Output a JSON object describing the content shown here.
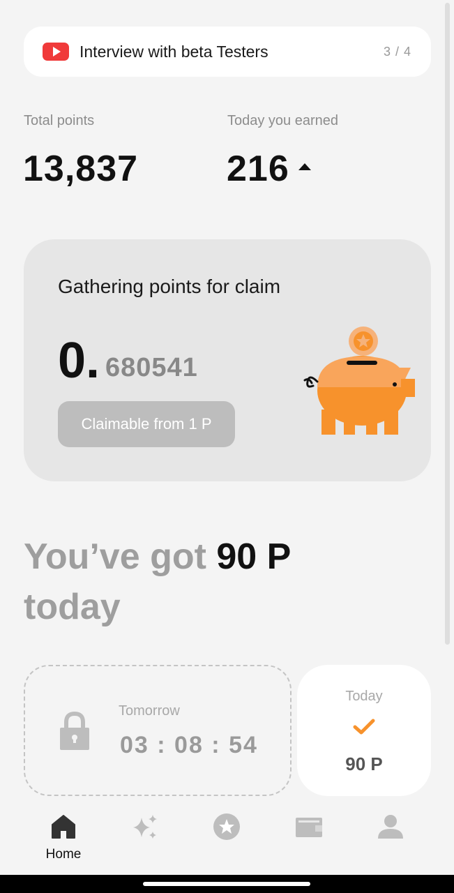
{
  "banner": {
    "icon": "youtube-play-icon",
    "title": "Interview with beta Testers",
    "counter": "3 / 4"
  },
  "stats": {
    "total_label": "Total points",
    "total_value": "13,837",
    "today_label": "Today you earned",
    "today_value": "216",
    "today_trend_icon": "arrow-up-icon"
  },
  "claim": {
    "title": "Gathering points for claim",
    "value_integer": "0.",
    "value_fraction": "680541",
    "button_label": "Claimable from 1 P",
    "illustration": "piggy-bank-icon"
  },
  "headline": {
    "prefix": "You’ve got ",
    "amount": "90 P",
    "suffix": "today"
  },
  "streak": {
    "tomorrow_label": "Tomorrow",
    "countdown": "03 : 08 : 54",
    "tomorrow_icon": "lock-icon",
    "today_label": "Today",
    "today_icon": "check-icon",
    "today_points": "90 P"
  },
  "nav": {
    "items": [
      {
        "label": "Home",
        "icon": "home-icon",
        "active": true
      },
      {
        "label": "",
        "icon": "sparkles-icon",
        "active": false
      },
      {
        "label": "",
        "icon": "star-badge-icon",
        "active": false
      },
      {
        "label": "",
        "icon": "wallet-icon",
        "active": false
      },
      {
        "label": "",
        "icon": "profile-icon",
        "active": false
      }
    ]
  },
  "colors": {
    "accent": "#f7922c",
    "background": "#f4f4f4",
    "youtube": "#f03a3a"
  }
}
